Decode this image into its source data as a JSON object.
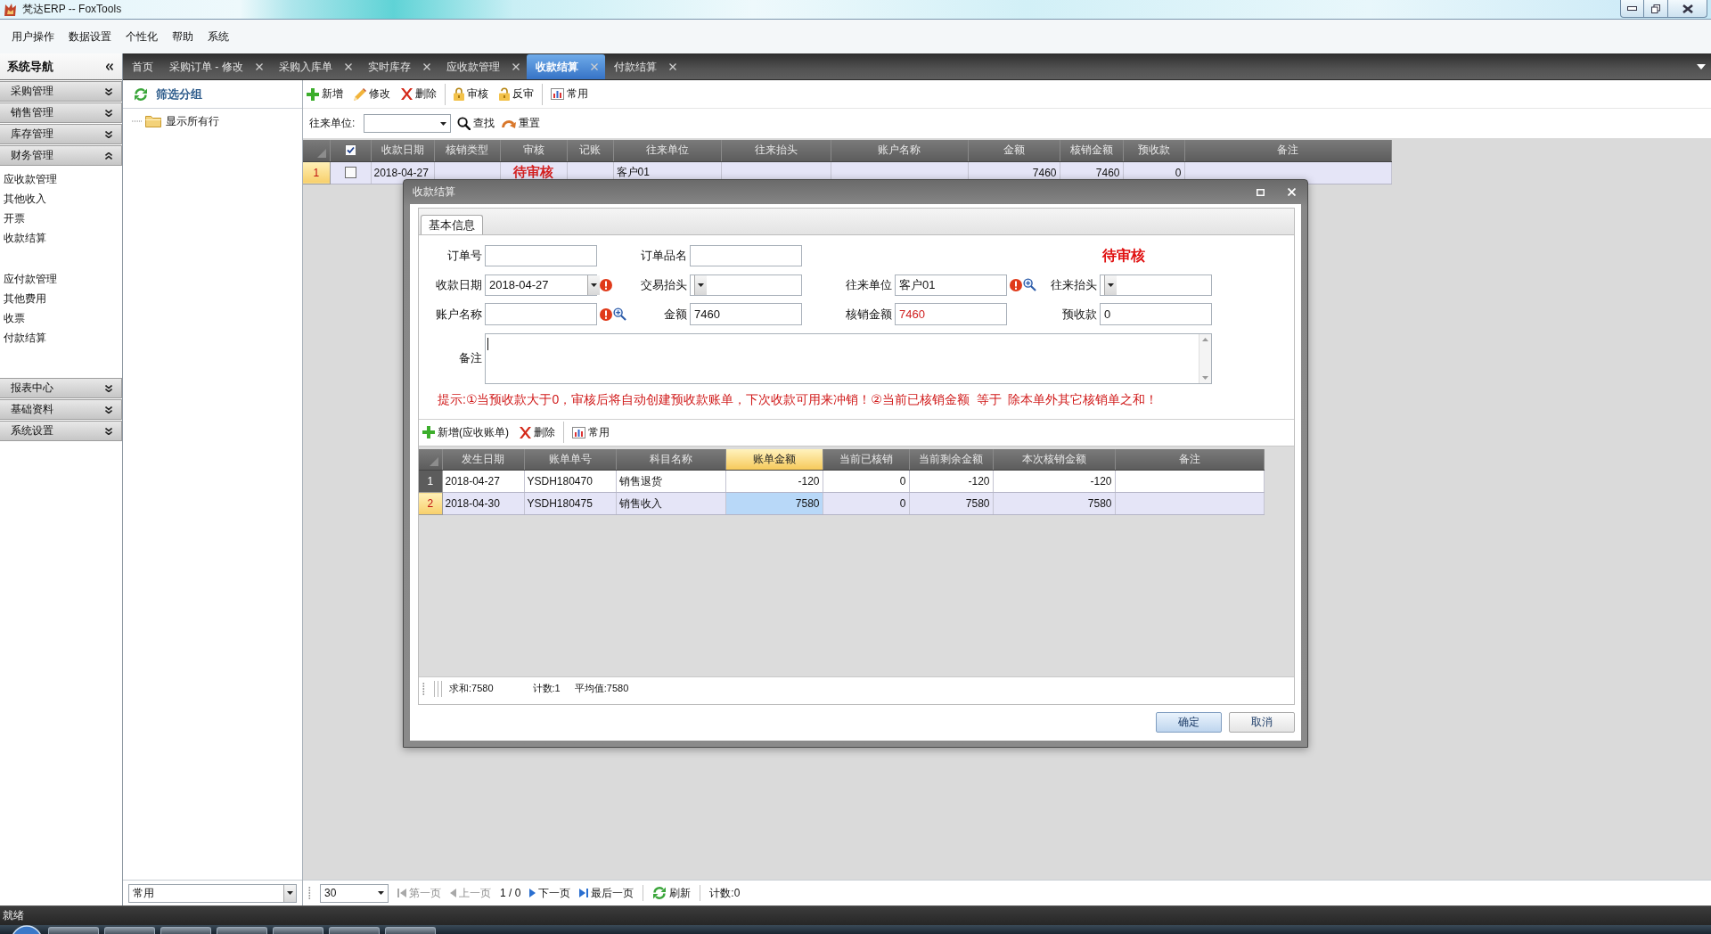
{
  "window": {
    "title": "梵达ERP -- FoxTools"
  },
  "menu": [
    "用户操作",
    "数据设置",
    "个性化",
    "帮助",
    "系统"
  ],
  "sidebar": {
    "title": "系统导航",
    "groups": [
      {
        "label": "采购管理",
        "expanded": false
      },
      {
        "label": "销售管理",
        "expanded": false
      },
      {
        "label": "库存管理",
        "expanded": false
      },
      {
        "label": "财务管理",
        "expanded": true,
        "sections": [
          [
            "应收款管理",
            "其他收入",
            "开票",
            "收款结算"
          ],
          [
            "应付款管理",
            "其他费用",
            "收票",
            "付款结算"
          ]
        ]
      },
      {
        "label": "报表中心",
        "expanded": false
      },
      {
        "label": "基础资料",
        "expanded": false
      },
      {
        "label": "系统设置",
        "expanded": false
      }
    ]
  },
  "tabs": [
    {
      "label": "首页",
      "closable": false,
      "selected": false
    },
    {
      "label": "采购订单 - 修改",
      "closable": true,
      "selected": false
    },
    {
      "label": "采购入库单",
      "closable": true,
      "selected": false
    },
    {
      "label": "实时库存",
      "closable": true,
      "selected": false
    },
    {
      "label": "应收款管理",
      "closable": true,
      "selected": false
    },
    {
      "label": "收款结算",
      "closable": true,
      "selected": true
    },
    {
      "label": "付款结算",
      "closable": true,
      "selected": false
    }
  ],
  "filter_panel": {
    "title": "筛选分组",
    "tree": [
      {
        "label": "显示所有行"
      }
    ],
    "view": "常用"
  },
  "toolbar": [
    [
      {
        "kind": "add",
        "label": "新增"
      },
      {
        "kind": "edit",
        "label": "修改"
      },
      {
        "kind": "delete",
        "label": "删除"
      }
    ],
    [
      {
        "kind": "lock",
        "label": "审核"
      },
      {
        "kind": "unlock",
        "label": "反审"
      }
    ],
    [
      {
        "kind": "chart",
        "label": "常用"
      }
    ]
  ],
  "search": {
    "label": "往来单位:",
    "buttons": [
      {
        "kind": "search",
        "label": "查找"
      },
      {
        "kind": "reset",
        "label": "重置"
      }
    ]
  },
  "table": {
    "select_all": true,
    "columns": [
      {
        "label": "收款日期",
        "kind": "text"
      },
      {
        "label": "核销类型",
        "kind": "text"
      },
      {
        "label": "审核",
        "kind": "status"
      },
      {
        "label": "记账",
        "kind": "text"
      },
      {
        "label": "往来单位",
        "kind": "text"
      },
      {
        "label": "往来抬头",
        "kind": "text"
      },
      {
        "label": "账户名称",
        "kind": "text"
      },
      {
        "label": "金额",
        "kind": "number"
      },
      {
        "label": "核销金额",
        "kind": "number"
      },
      {
        "label": "预收款",
        "kind": "number"
      },
      {
        "label": "备注",
        "kind": "text"
      }
    ],
    "rows": [
      {
        "number": "1",
        "selected": true,
        "checked": false,
        "cells": [
          "2018-04-27",
          null,
          "待审核",
          null,
          "客户01",
          null,
          null,
          "7460",
          "7460",
          "0",
          null
        ]
      }
    ]
  },
  "pager": {
    "page_size": "30",
    "items": [
      {
        "kind": "first",
        "label": "第一页",
        "disabled": true
      },
      {
        "kind": "prev",
        "label": "上一页",
        "disabled": true
      },
      {
        "kind": "page",
        "label": "1 / 0"
      },
      {
        "kind": "next",
        "label": "下一页",
        "disabled": false
      },
      {
        "kind": "last",
        "label": "最后一页",
        "disabled": false
      },
      {
        "kind": "refresh",
        "label": "刷新",
        "disabled": false
      },
      {
        "kind": "count",
        "label": "计数:0"
      }
    ]
  },
  "dialog": {
    "title": "收款结算",
    "tabs": [
      {
        "label": "基本信息",
        "selected": true
      }
    ],
    "form_rows": [
      [
        {
          "label": "订单号",
          "kind": "text",
          "required": false,
          "lookup": false
        },
        {
          "label": "订单品名",
          "kind": "text",
          "required": false,
          "lookup": false
        },
        null,
        {
          "kind": "status",
          "text": "待审核"
        }
      ],
      [
        {
          "label": "收款日期",
          "kind": "combo",
          "value": "2018-04-27",
          "required": true,
          "lookup": false
        },
        {
          "label": "交易抬头",
          "kind": "combo",
          "required": false,
          "lookup": false
        },
        {
          "label": "往来单位",
          "kind": "text",
          "value": "客户01",
          "required": true,
          "lookup": true
        },
        {
          "label": "往来抬头",
          "kind": "combo",
          "required": false,
          "lookup": false
        }
      ],
      [
        {
          "label": "账户名称",
          "kind": "text",
          "required": true,
          "lookup": true
        },
        {
          "label": "金额",
          "kind": "text",
          "value": "7460",
          "required": false,
          "lookup": false
        },
        {
          "label": "核销金额",
          "kind": "computed",
          "value": "7460",
          "required": false,
          "lookup": false
        },
        {
          "label": "预收款",
          "kind": "text",
          "value": "0",
          "required": false,
          "lookup": false
        }
      ],
      [
        {
          "label": "备注",
          "kind": "memo",
          "focused": true,
          "required": false,
          "lookup": false
        }
      ]
    ],
    "hint": "提示:①当预收款大于0，审核后将自动创建预收款账单，下次收款可用来冲销！②当前已核销金额  等于  除本单外其它核销单之和！",
    "sub_toolbar": [
      [
        {
          "kind": "add",
          "label": "新增(应收账单)"
        },
        {
          "kind": "delete",
          "label": "删除"
        }
      ],
      [
        {
          "kind": "chart",
          "label": "常用"
        }
      ]
    ],
    "sub_table": {
      "columns": [
        {
          "label": "发生日期",
          "kind": "text",
          "selected": false
        },
        {
          "label": "账单单号",
          "kind": "text",
          "selected": false
        },
        {
          "label": "科目名称",
          "kind": "text",
          "selected": false
        },
        {
          "label": "账单金额",
          "kind": "number",
          "selected": true
        },
        {
          "label": "当前已核销",
          "kind": "number",
          "selected": false
        },
        {
          "label": "当前剩余金额",
          "kind": "number",
          "selected": false
        },
        {
          "label": "本次核销金额",
          "kind": "number",
          "selected": false
        },
        {
          "label": "备注",
          "kind": "text",
          "selected": false
        }
      ],
      "rows": [
        {
          "number": "1",
          "selected": false,
          "cells": [
            "2018-04-27",
            "YSDH180470",
            "销售退货",
            "-120",
            "0",
            "-120",
            "-120",
            null
          ]
        },
        {
          "number": "2",
          "selected": true,
          "cells": [
            "2018-04-30",
            "YSDH180475",
            "销售收入",
            "7580",
            "0",
            "7580",
            "7580",
            null
          ]
        }
      ]
    },
    "summary": [
      "求和:7580",
      "计数:1",
      "平均值:7580"
    ],
    "buttons": [
      {
        "label": "确定",
        "default": true
      },
      {
        "label": "取消",
        "default": false
      }
    ]
  },
  "status_bar": "就绪"
}
